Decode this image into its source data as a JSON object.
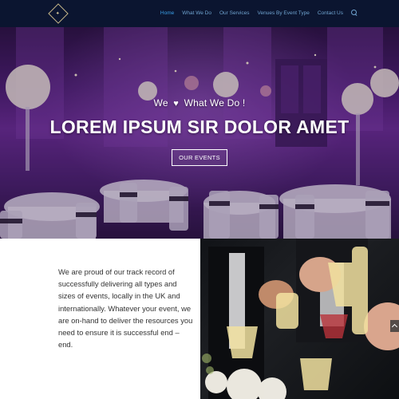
{
  "header": {
    "nav": [
      {
        "label": "Home",
        "active": true
      },
      {
        "label": "What We Do"
      },
      {
        "label": "Our Services"
      },
      {
        "label": "Venues By Event Type"
      },
      {
        "label": "Contact Us"
      }
    ],
    "search_icon": "search-icon"
  },
  "hero": {
    "tagline_before": "We",
    "tagline_after": "What We Do !",
    "heart_icon": "heart-icon",
    "title": "LOREM IPSUM SIR DOLOR AMET",
    "button_label": "OUR EVENTS"
  },
  "about": {
    "text": "We are proud of our track record of successfully delivering all types and sizes of events, locally in the UK and internationally. Whatever your event, we are on-hand to deliver the resources you need to ensure it is successful end – end."
  },
  "colors": {
    "header_bg": "#0b1530",
    "nav_active": "#3aa0e8",
    "nav_link": "#6fa3cf",
    "hero_tint": "#6a2c94"
  }
}
